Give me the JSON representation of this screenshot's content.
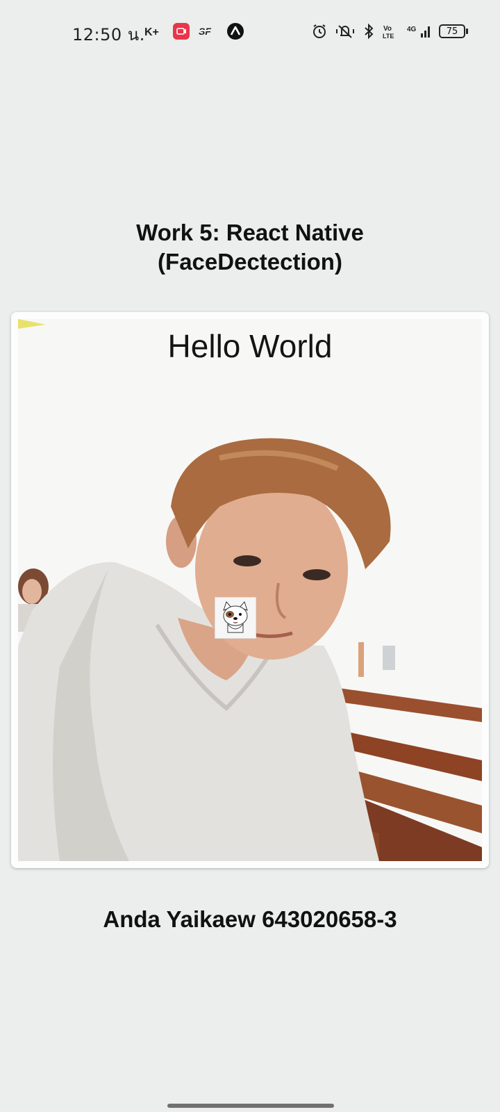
{
  "status_bar": {
    "time": "12:50 น.",
    "battery": "75",
    "network": "4G",
    "left_icons": [
      "kplus-icon",
      "screen-record-icon",
      "sf-icon",
      "expo-icon"
    ],
    "right_icons": [
      "alarm-icon",
      "vibrate-icon",
      "bluetooth-icon",
      "volte-icon",
      "signal-icon",
      "battery-icon"
    ]
  },
  "app": {
    "title_line1": "Work 5: React Native",
    "title_line2": "(FaceDectection)",
    "camera_overlay_text": "Hello World",
    "author": "Anda Yaikaew 643020658-3"
  },
  "colors": {
    "background": "#ebeeed",
    "card": "#fdfdfd",
    "text": "#111111"
  }
}
